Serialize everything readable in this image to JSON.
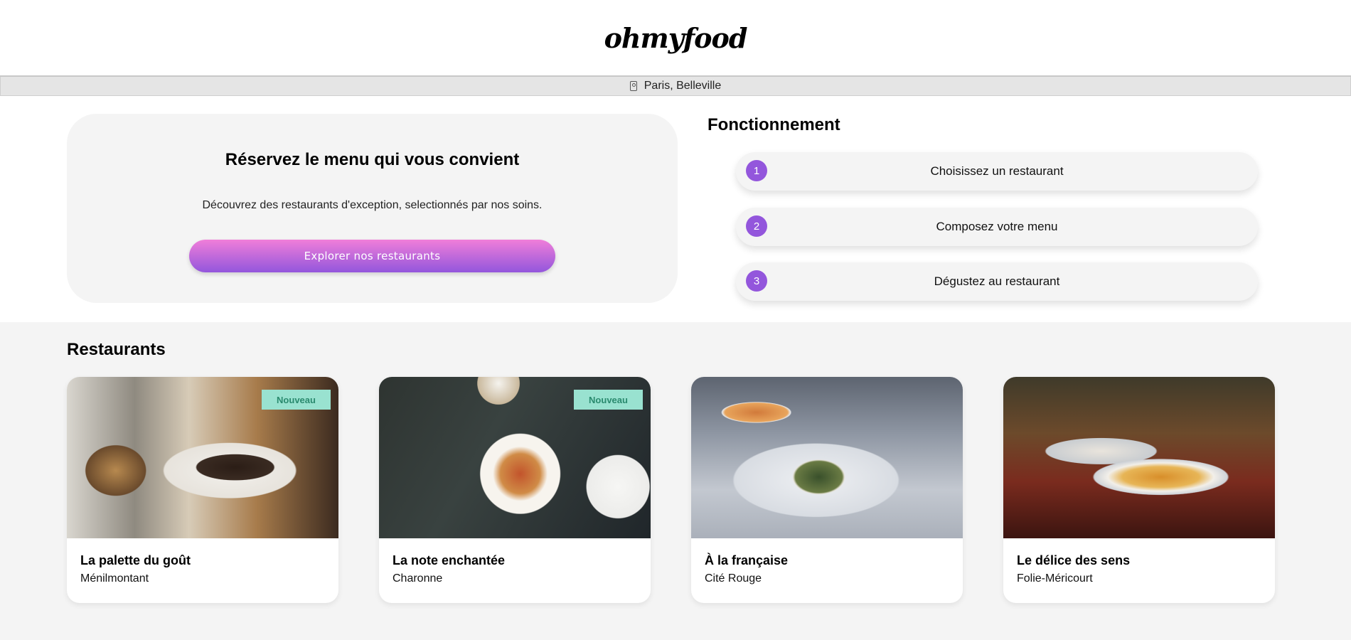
{
  "header": {
    "logo": "ohmyfood"
  },
  "location": {
    "icon": "location-pin-icon",
    "text": "Paris, Belleville"
  },
  "hero": {
    "title": "Réservez le menu qui vous convient",
    "text": "Découvrez des restaurants d'exception, selectionnés par nos soins.",
    "button_label": "Explorer nos restaurants"
  },
  "steps": {
    "title": "Fonctionnement",
    "items": [
      {
        "number": "1",
        "label": "Choisissez un restaurant"
      },
      {
        "number": "2",
        "label": "Composez votre menu"
      },
      {
        "number": "3",
        "label": "Dégustez au restaurant"
      }
    ]
  },
  "restaurants": {
    "title": "Restaurants",
    "items": [
      {
        "name": "La palette du goût",
        "area": "Ménilmontant",
        "badge": "Nouveau"
      },
      {
        "name": "La note enchantée",
        "area": "Charonne",
        "badge": "Nouveau"
      },
      {
        "name": "À la française",
        "area": "Cité Rouge",
        "badge": ""
      },
      {
        "name": "Le délice des sens",
        "area": "Folie-Méricourt",
        "badge": ""
      }
    ]
  },
  "colors": {
    "accent_purple": "#9356dc",
    "accent_pink": "#f07ed9",
    "badge_background": "#99e2d0",
    "badge_text": "#2a8a6e",
    "panel_background": "#f4f4f4"
  }
}
